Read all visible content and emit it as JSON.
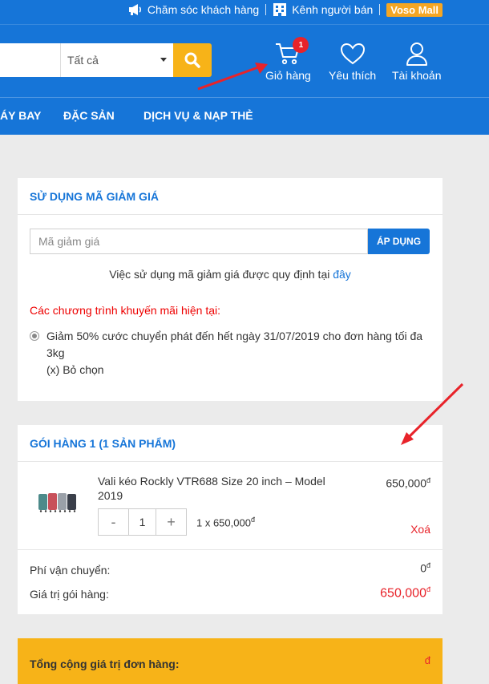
{
  "topbar": {
    "support_label": "Chăm sóc khách hàng",
    "seller_label": "Kênh người bán",
    "mall_label": "Voso Mall"
  },
  "search": {
    "placeholder": "",
    "category": "Tất cả"
  },
  "header_icons": {
    "cart_label": "Giỏ hàng",
    "cart_count": "1",
    "wishlist_label": "Yêu thích",
    "account_label": "Tài khoản"
  },
  "nav": {
    "items": [
      "ÁY BAY",
      "ĐẶC SẢN",
      "DỊCH VỤ & NẠP THẺ"
    ]
  },
  "coupon": {
    "title": "SỬ DỤNG MÃ GIẢM GIÁ",
    "input_placeholder": "Mã giảm giá",
    "apply_label": "ÁP DỤNG",
    "note": "Việc sử dụng mã giảm giá được quy định tại",
    "note_link": "đây",
    "promo_title": "Các chương trình khuyến mãi hiện tại:",
    "promo_text": "Giảm 50% cước chuyển phát đến hết ngày 31/07/2019 cho đơn hàng tối đa 3kg",
    "promo_deselect": "(x) Bỏ chọn"
  },
  "package": {
    "title": "GÓI HÀNG 1 (1 SẢN PHẨM)",
    "product_name": "Vali kéo Rockly VTR688 Size 20 inch – Model 2019",
    "product_price": "650,000",
    "currency": "đ",
    "qty_minus": "-",
    "qty_value": "1",
    "qty_plus": "+",
    "qty_text": "1 x 650,000",
    "delete_label": "Xoá",
    "shipping_label": "Phí vận chuyển:",
    "shipping_value": "0",
    "package_value_label": "Giá trị gói hàng:",
    "package_value": "650,000"
  },
  "total": {
    "label": "Tổng cộng giá trị đơn hàng:",
    "value": "đ"
  },
  "colors": {
    "header_blue": "#1675d8",
    "accent_yellow": "#f7b318",
    "red": "#e8232a"
  }
}
